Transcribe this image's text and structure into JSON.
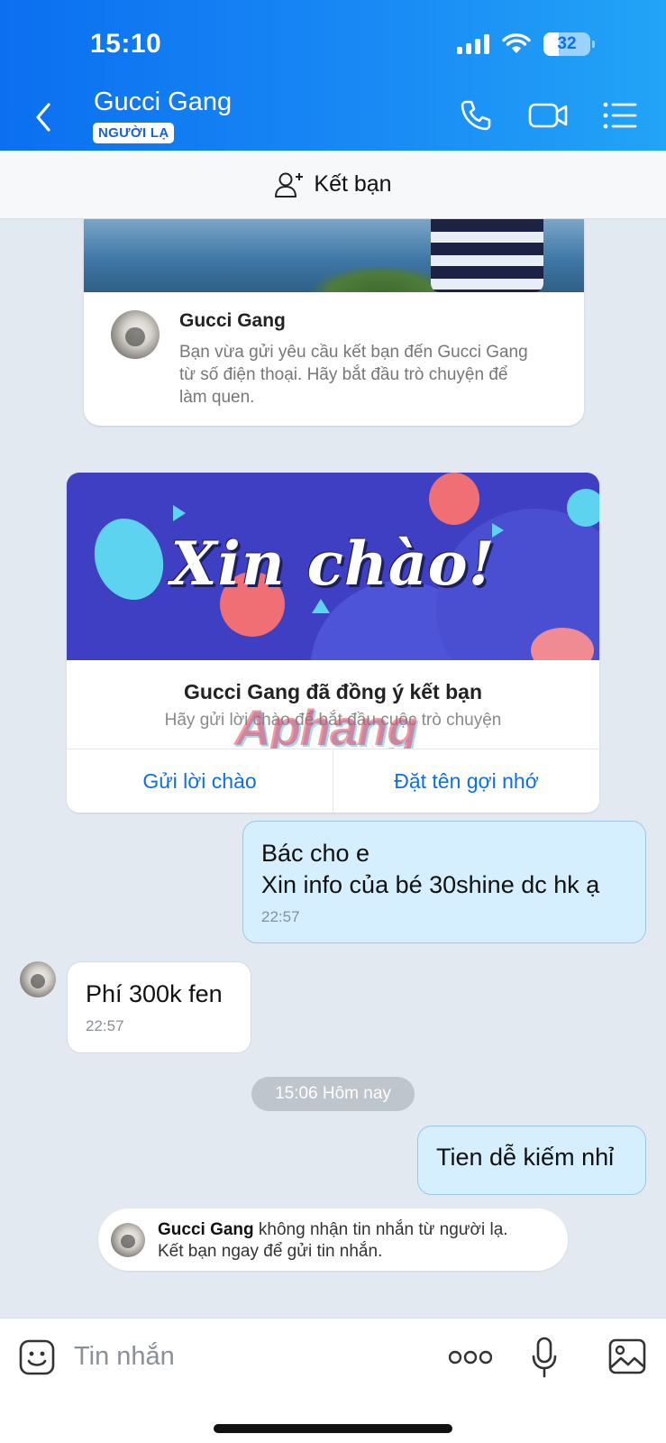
{
  "status_bar": {
    "time": "15:10",
    "battery": "32",
    "battery_level": 0.32
  },
  "header": {
    "back_icon": "chevron-left-icon",
    "contact_name": "Gucci Gang",
    "badge": "NGƯỜI LẠ",
    "icons": [
      "phone-icon",
      "video-camera-icon",
      "menu-list-icon"
    ]
  },
  "friend_bar": {
    "label": "Kết bạn",
    "icon": "add-user-icon"
  },
  "profile_card": {
    "name": "Gucci Gang",
    "description": "Bạn vừa gửi yêu cầu kết bạn đến Gucci Gang từ số điện thoại. Hãy bắt đầu trò chuyện để làm quen."
  },
  "greeting_card": {
    "banner_text": "Xin chào!",
    "heading": "Gucci Gang đã đồng ý kết bạn",
    "subtext": "Hãy gửi lời chào để bắt đầu cuộc trò chuyện",
    "watermark": "Aphang",
    "actions": [
      "Gửi lời chào",
      "Đặt tên gợi nhớ"
    ]
  },
  "messages": [
    {
      "direction": "out",
      "text": "Bác cho e\nXin info của bé 30shine dc hk ạ",
      "time": "22:57"
    },
    {
      "direction": "in",
      "text": "Phí 300k fen",
      "time": "22:57"
    },
    {
      "direction": "out",
      "text": "Tien dễ kiếm nhỉ",
      "time": ""
    }
  ],
  "date_separator": "15:06 Hôm nay",
  "notice": {
    "name": "Gucci Gang",
    "text": " không nhận tin nhắn từ người lạ.\nKết bạn ngay để gửi tin nhắn."
  },
  "input_bar": {
    "placeholder": "Tin nhắn",
    "icons": [
      "emoji-icon",
      "more-icon",
      "microphone-icon",
      "image-icon"
    ]
  },
  "colors": {
    "header_start": "#0b6ff0",
    "header_end": "#22a4f7",
    "accent": "#0d6fe8",
    "out_bubble": "#d5efff",
    "chat_bg": "#e2e9f1"
  }
}
